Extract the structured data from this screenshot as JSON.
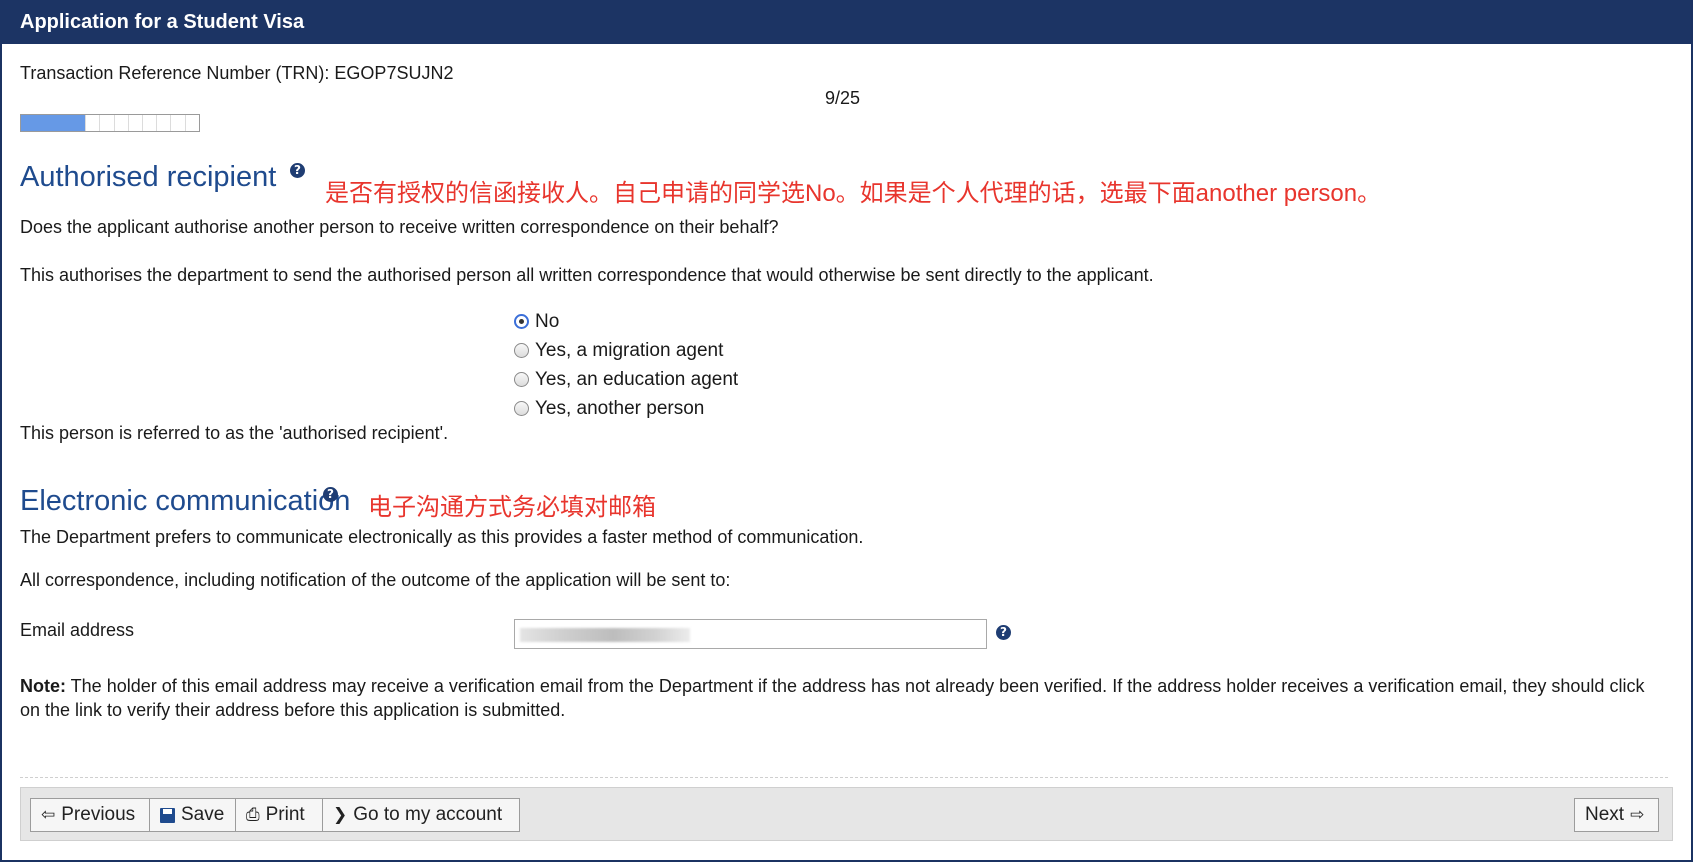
{
  "window": {
    "title": "Application for a Student Visa"
  },
  "header": {
    "trn_label": "Transaction Reference Number (TRN): EGOP7SUJN2",
    "page_counter": "9/25",
    "progress_fraction": 0.36
  },
  "authorised_recipient": {
    "heading": "Authorised recipient",
    "help_icon": "question-circle-icon",
    "annotation": "是否有授权的信函接收人。自己申请的同学选No。如果是个人代理的话，选最下面another person。",
    "question": "Does the applicant authorise another person to receive written correspondence on their behalf?",
    "explanation": "This authorises the department to send the authorised person all written correspondence that would otherwise be sent directly to the applicant.",
    "options": [
      {
        "label": "No",
        "checked": true
      },
      {
        "label": "Yes, a migration agent",
        "checked": false
      },
      {
        "label": "Yes, an education agent",
        "checked": false
      },
      {
        "label": "Yes, another person",
        "checked": false
      }
    ],
    "footnote": "This person is referred to as the 'authorised recipient'."
  },
  "electronic_communication": {
    "heading": "Electronic communication",
    "annotation": "电子沟通方式务必填对邮箱",
    "para1": "The Department prefers to communicate electronically as this provides a faster method of communication.",
    "para2": "All correspondence, including notification of the outcome of the application will be sent to:",
    "email_label": "Email address",
    "note_label": "Note:",
    "note_text": " The holder of this email address may receive a verification email from the Department if the address has not already been verified. If the address holder receives a verification email, they should click on the link to verify their address before this application is submitted."
  },
  "footer": {
    "previous": "Previous",
    "save": "Save",
    "print": "Print",
    "account": "Go to my account",
    "next": "Next"
  },
  "colors": {
    "title_bar": "#1c3464",
    "heading": "#1f4b8e",
    "annotation": "#e8352d",
    "progress_fill": "#6699e6"
  }
}
